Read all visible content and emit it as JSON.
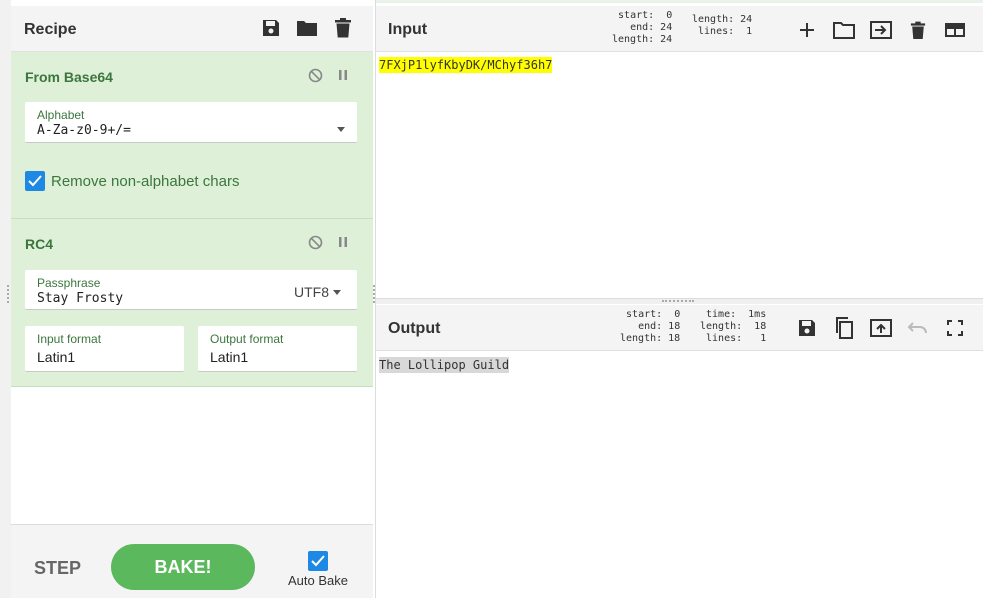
{
  "recipe": {
    "title": "Recipe",
    "icons": [
      "save-icon",
      "folder-icon",
      "trash-icon"
    ]
  },
  "operations": {
    "base64": {
      "title": "From Base64",
      "alphabet_label": "Alphabet",
      "alphabet_value": "A-Za-z0-9+/=",
      "remove_label": "Remove non-alphabet chars",
      "remove_checked": true
    },
    "rc4": {
      "title": "RC4",
      "passphrase_label": "Passphrase",
      "passphrase_value": "Stay Frosty",
      "encoding": "UTF8",
      "input_format_label": "Input format",
      "input_format_value": "Latin1",
      "output_format_label": "Output format",
      "output_format_value": "Latin1"
    }
  },
  "controls": {
    "step": "STEP",
    "bake": "BAKE!",
    "autobake_label": "Auto Bake",
    "autobake_checked": true
  },
  "input": {
    "title": "Input",
    "stats_sel": "start:  0\n  end: 24\nlength: 24",
    "stats_len": "length: 24\n lines:  1",
    "text": "7FXjP1lyfKbyDK/MChyf36h7"
  },
  "output": {
    "title": "Output",
    "stats_sel": "start:  0\n  end: 18\nlength: 18",
    "stats_time": "time:  1ms\nlength:  18\n lines:   1",
    "text": "The Lollipop Guild"
  },
  "colors": {
    "op_bg": "#dff0d8",
    "op_title": "#3c763d",
    "bake": "#5cb85c",
    "checkbox": "#1e88e5",
    "input_highlight": "#ffff00",
    "output_highlight": "#d8d8d8"
  }
}
